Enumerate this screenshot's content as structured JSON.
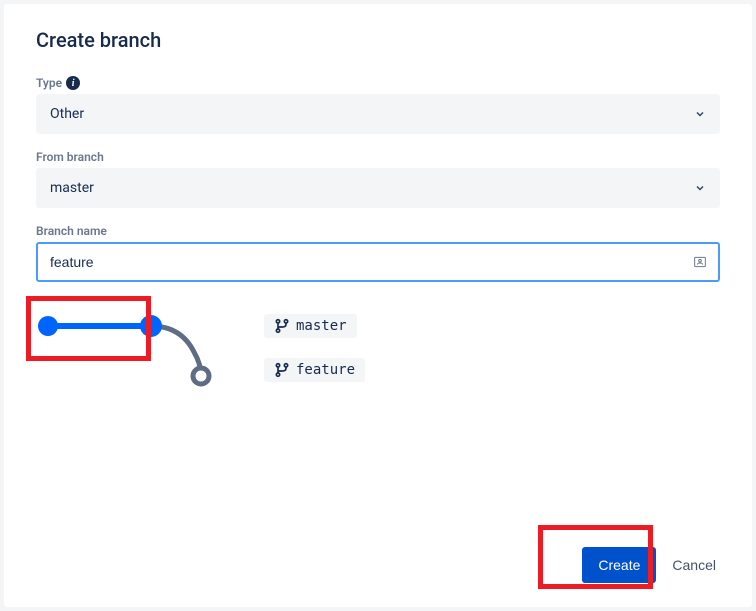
{
  "dialog": {
    "title": "Create branch"
  },
  "fields": {
    "type": {
      "label": "Type",
      "value": "Other"
    },
    "from_branch": {
      "label": "From branch",
      "value": "master"
    },
    "branch_name": {
      "label": "Branch name",
      "value": "feature"
    }
  },
  "branches": {
    "source": "master",
    "target": "feature"
  },
  "actions": {
    "create": "Create",
    "cancel": "Cancel"
  }
}
